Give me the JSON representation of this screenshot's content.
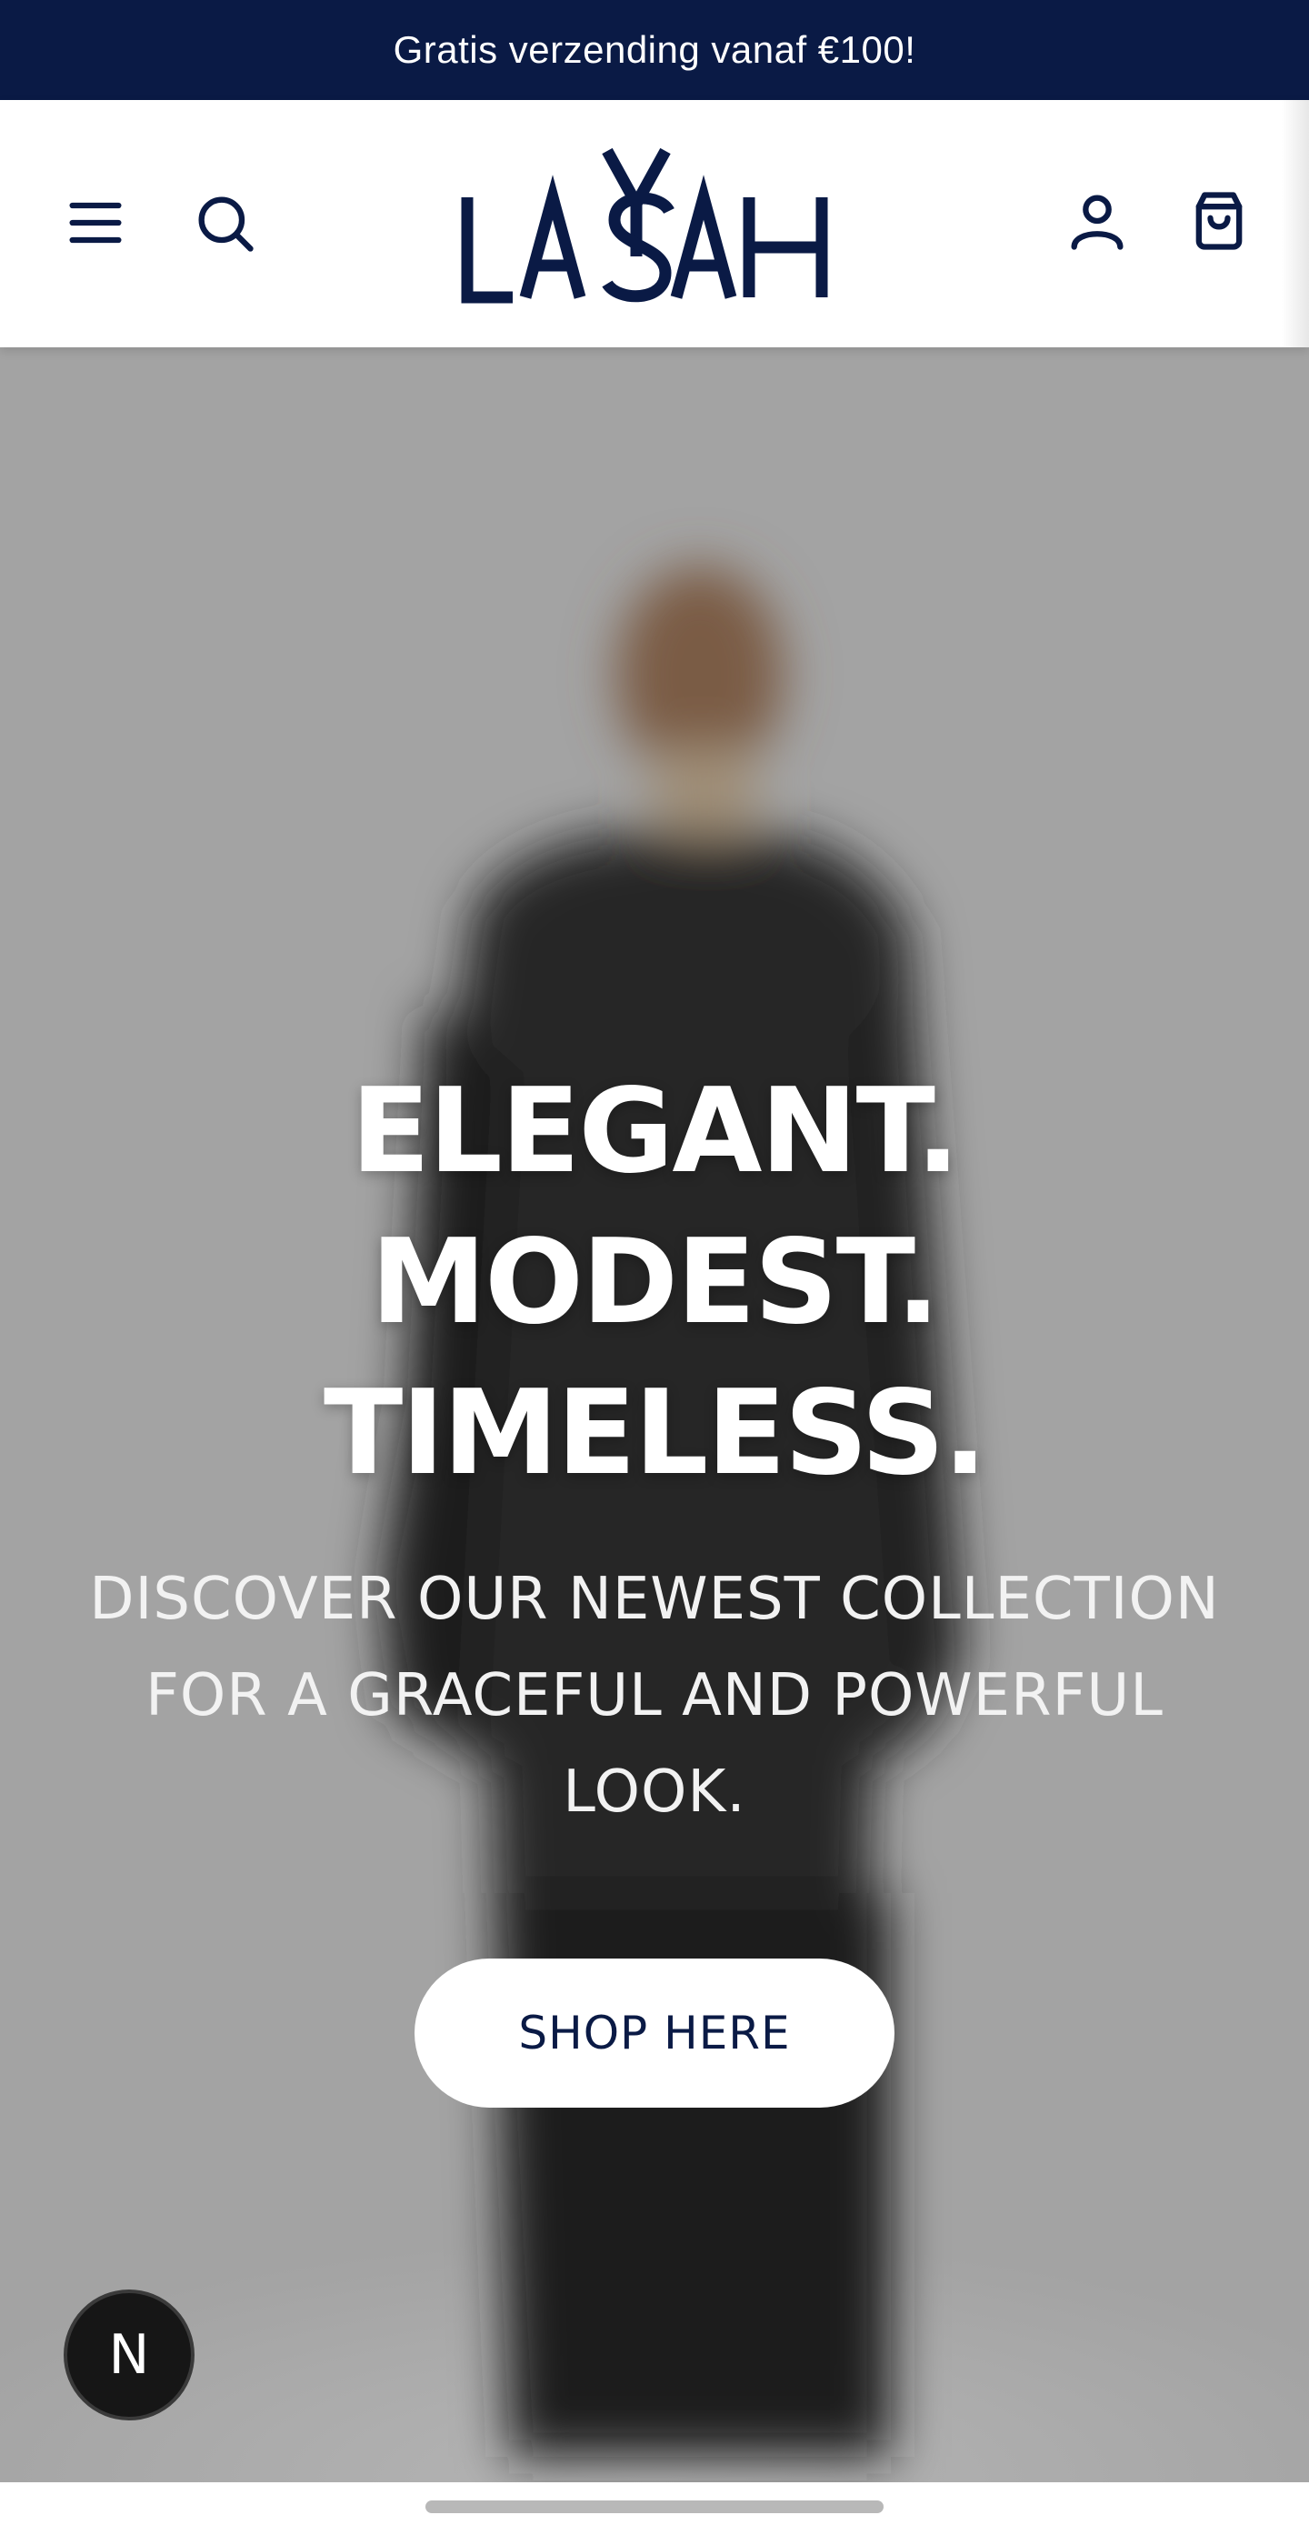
{
  "announcement": {
    "text": "Gratis verzending vanaf €100!"
  },
  "header": {
    "logo_text": "LAYSAH",
    "icons": {
      "menu": "hamburger-menu-icon",
      "search": "search-icon",
      "account": "user-icon",
      "cart": "shopping-bag-icon"
    },
    "brand_color": "#0a1a45"
  },
  "hero": {
    "title": "ELEGANT. MODEST. TIMELESS.",
    "subtitle": "DISCOVER OUR NEWEST COLLECTION FOR A GRACEFUL AND POWERFUL LOOK.",
    "cta_label": "SHOP HERE",
    "background_color": "#a3a3a3"
  },
  "badge": {
    "label": "N"
  }
}
